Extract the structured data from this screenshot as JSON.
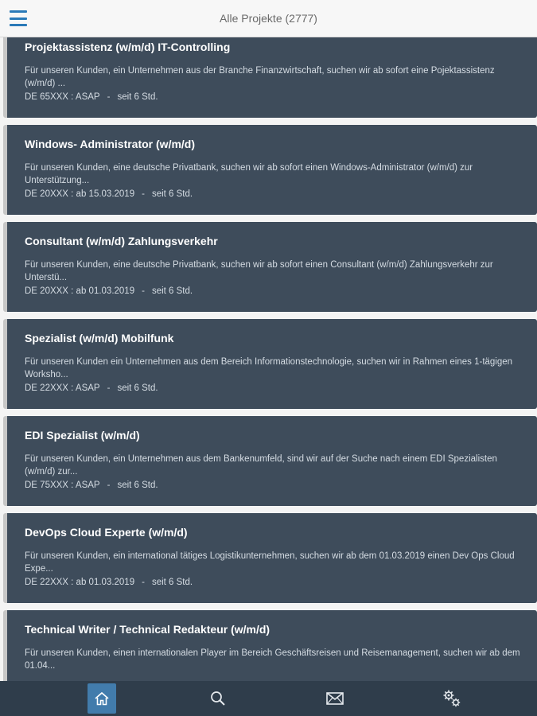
{
  "header": {
    "title": "Alle Projekte (2777)",
    "menu_icon": "hamburger-menu-icon"
  },
  "projects": [
    {
      "title": "Projektassistenz (w/m/d) IT-Controlling",
      "description": "Für unseren Kunden, ein Unternehmen aus der Branche Finanzwirtschaft, suchen wir ab sofort eine Pojektassistenz (w/m/d) ...",
      "location_start": "DE 65XXX : ASAP",
      "age": "seit 6 Std."
    },
    {
      "title": "Windows- Administrator (w/m/d)",
      "description": "Für unseren Kunden, eine deutsche Privatbank, suchen wir ab sofort einen Windows-Administrator (w/m/d) zur Unterstützung...",
      "location_start": "DE 20XXX : ab 15.03.2019",
      "age": "seit 6 Std."
    },
    {
      "title": "Consultant (w/m/d) Zahlungsverkehr",
      "description": "Für unseren Kunden, eine deutsche Privatbank, suchen wir ab sofort einen Consultant (w/m/d) Zahlungsverkehr zur Unterstü...",
      "location_start": "DE 20XXX : ab 01.03.2019",
      "age": "seit 6 Std."
    },
    {
      "title": "Spezialist (w/m/d) Mobilfunk",
      "description": "Für unseren Kunden ein Unternehmen aus dem Bereich Informationstechnologie, suchen wir in Rahmen eines 1-tägigen Worksho...",
      "location_start": "DE 22XXX : ASAP",
      "age": "seit 6 Std."
    },
    {
      "title": "EDI Spezialist (w/m/d)",
      "description": "Für unseren Kunden, ein Unternehmen aus dem Bankenumfeld, sind wir auf der Suche nach einem EDI Spezialisten (w/m/d) zur...",
      "location_start": "DE 75XXX : ASAP",
      "age": "seit 6 Std."
    },
    {
      "title": "DevOps Cloud Experte (w/m/d)",
      "description": "Für unseren Kunden, ein international tätiges Logistikunternehmen, suchen wir ab dem 01.03.2019 einen Dev Ops Cloud Expe...",
      "location_start": "DE 22XXX : ab 01.03.2019",
      "age": "seit 6 Std."
    },
    {
      "title": "Technical Writer / Technical Redakteur (w/m/d)",
      "description": "Für unseren Kunden, einen internationalen Player im Bereich Geschäftsreisen und Reisemanagement, suchen wir ab dem 01.04...",
      "location_start": "",
      "age": ""
    }
  ],
  "bottom_nav": {
    "items": [
      {
        "icon": "home-icon",
        "active": true
      },
      {
        "icon": "search-icon",
        "active": false
      },
      {
        "icon": "mail-icon",
        "active": false
      },
      {
        "icon": "settings-gears-icon",
        "active": false
      }
    ]
  },
  "colors": {
    "card_background": "#3e4c5b",
    "bottom_bar": "#2f3d4b",
    "accent": "#427cac",
    "menu_icon": "#2a7ab8"
  }
}
